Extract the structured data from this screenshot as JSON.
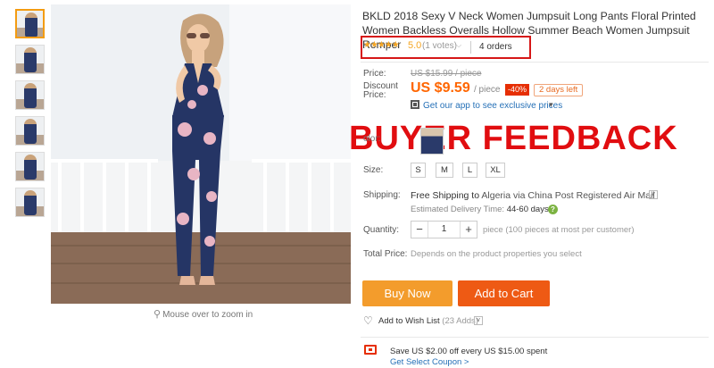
{
  "product": {
    "title": "BKLD 2018 Sexy V Neck Women Jumpsuit Long Pants Floral Printed Women Backless Overalls Hollow Summer Beach Women Jumpsuit Romper",
    "rating": {
      "stars": "★★★★★",
      "score": "5.0",
      "votes": "(1 votes)",
      "orders": "4 orders"
    }
  },
  "price": {
    "label": "Price:",
    "original": "US $15.99 / piece",
    "discount_label_1": "Discount",
    "discount_label_2": "Price:",
    "current": "US $9.59",
    "per": "/ piece",
    "discount_badge": "-40%",
    "time_left": "2 days left",
    "app_promo": "Get our app to see exclusive prices",
    "app_chevron": "▾"
  },
  "overlay_text": "BUYER FEEDBACK",
  "color": {
    "label_fragment": "olor:"
  },
  "size": {
    "label": "Size:",
    "options": [
      "S",
      "M",
      "L",
      "XL"
    ]
  },
  "shipping": {
    "label": "Shipping:",
    "text_1": "Free Shipping to",
    "country": "Algeria",
    "text_2": "via China Post Registered Air Mail",
    "est_label": "Estimated Delivery Time:",
    "est_value": "44-60 days",
    "help_glyph": "?"
  },
  "quantity": {
    "label": "Quantity:",
    "minus": "−",
    "value": "1",
    "plus": "+",
    "note": "piece (100 pieces at most per customer)"
  },
  "total": {
    "label": "Total Price:",
    "note": "Depends on the product properties you select"
  },
  "actions": {
    "buy_now": "Buy Now",
    "add_to_cart": "Add to Cart"
  },
  "wishlist": {
    "label": "Add to Wish List",
    "count": "(23 Adds)"
  },
  "coupon": {
    "text": "Save US $2.00 off every US $15.00 spent",
    "link": "Get Select Coupon >"
  },
  "gallery": {
    "zoom_hint": "Mouse over to zoom in",
    "thumbnail_count": 6
  },
  "colors": {
    "accent_orange": "#ff6600",
    "buy_now": "#f39c2c",
    "add_to_cart": "#ee5a14",
    "overlay_red": "#e10d10",
    "link_blue": "#2570b7"
  }
}
